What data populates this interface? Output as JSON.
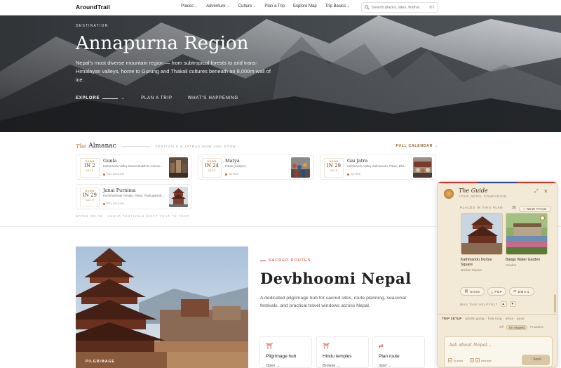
{
  "nav": {
    "logo": "AroundTrail",
    "menu": [
      {
        "label": "Places",
        "dropdown": true
      },
      {
        "label": "Adventure",
        "dropdown": true
      },
      {
        "label": "Culture",
        "dropdown": true
      },
      {
        "label": "Plan a Trip",
        "dropdown": false
      },
      {
        "label": "Explore Map",
        "dropdown": false
      },
      {
        "label": "Trip Basics",
        "dropdown": true
      }
    ],
    "search_placeholder": "Search places, sites, festiva",
    "search_shortcut": "⌘K"
  },
  "hero": {
    "kicker": "DESTINATION",
    "title": "Annapurna Region",
    "description": "Nepal's most diverse mountain region — from subtropical forests to arid trans-Himalayan valleys, home to Gurung and Thakali cultures beneath an 8,000m wall of ice.",
    "links": {
      "explore": "EXPLORE",
      "plan": "PLAN A TRIP",
      "happening": "WHAT'S HAPPENING"
    }
  },
  "almanac": {
    "the": "The",
    "title": "Almanac",
    "subtitle": "FESTIVALS & JATRAS NOW AND SOON",
    "full_calendar": "FULL CALENDAR →",
    "note": "DATES ON AD · LUNAR FESTIVALS SHIFT YEAR TO YEAR",
    "cards": [
      {
        "soon": "SOON",
        "day": "IN 2",
        "days": "DAYS",
        "name": "Gunla",
        "place": "Kathmandu Valley Newar Buddhist commu...",
        "tag": "RELIGIOUS"
      },
      {
        "soon": "SOON",
        "day": "IN 24",
        "days": "DAYS",
        "name": "Matya",
        "place": "Patan (Lalitpur)",
        "tag": "JATRA"
      },
      {
        "soon": "SOON",
        "day": "IN 29",
        "days": "DAYS",
        "name": "Gai Jatra",
        "place": "Kathmandu Valley Kathmandu, Patan, Bha...",
        "tag": "JATRA"
      },
      {
        "soon": "SOON",
        "day": "IN 29",
        "days": "DAYS",
        "name": "Janai Purnima",
        "place": "Kumbheshwar Temple, Patan; Pashupatinat...",
        "tag": "RELIGIOUS"
      }
    ]
  },
  "devbhoomi": {
    "image_tag": "PILGRIMAGE",
    "kicker": "SACRED ROUTES",
    "title": "Devbhoomi Nepal",
    "description": "A dedicated pilgrimage hub for sacred sites, route planning, seasonal festivals, and practical travel windows across Nepal.",
    "features": [
      {
        "icon": "⛩",
        "label": "Pilgrimage hub",
        "more": "Open →"
      },
      {
        "icon": "⛩",
        "label": "Hindu temples",
        "more": "Browse →"
      },
      {
        "icon": "⇄",
        "label": "Plan route",
        "more": "Start →"
      }
    ]
  },
  "guide": {
    "title": "The Guide",
    "subtitle": "YOUR NEPAL COMPANION",
    "places_label": "PLACES IN THIS PLAN",
    "count": "30",
    "new_page": "+ NEW PAGE",
    "places": [
      {
        "name": "Kathmandu Durbar Square",
        "type": "Durbar Square"
      },
      {
        "name": "Balaju Water Garden",
        "type": "Garden"
      }
    ],
    "actions": {
      "save": "SAVE",
      "pdf": "PDF",
      "email": "EMAIL"
    },
    "helpful": "WAS THIS HELPFUL?",
    "setup": {
      "label": "TRIP SETUP",
      "value": "adults going · how long · when · pace"
    },
    "tabs": [
      "Off",
      "On request",
      "Proactive"
    ],
    "active_tab": "On request",
    "input_placeholder": "Ask about Nepal...",
    "option_send": "to send",
    "option_newline": "new line",
    "send_label": "↑ Send"
  },
  "colors": {
    "accent": "#c0392b",
    "brand_gold": "#b77a3a",
    "guide_bg": "#f3e9d7"
  }
}
